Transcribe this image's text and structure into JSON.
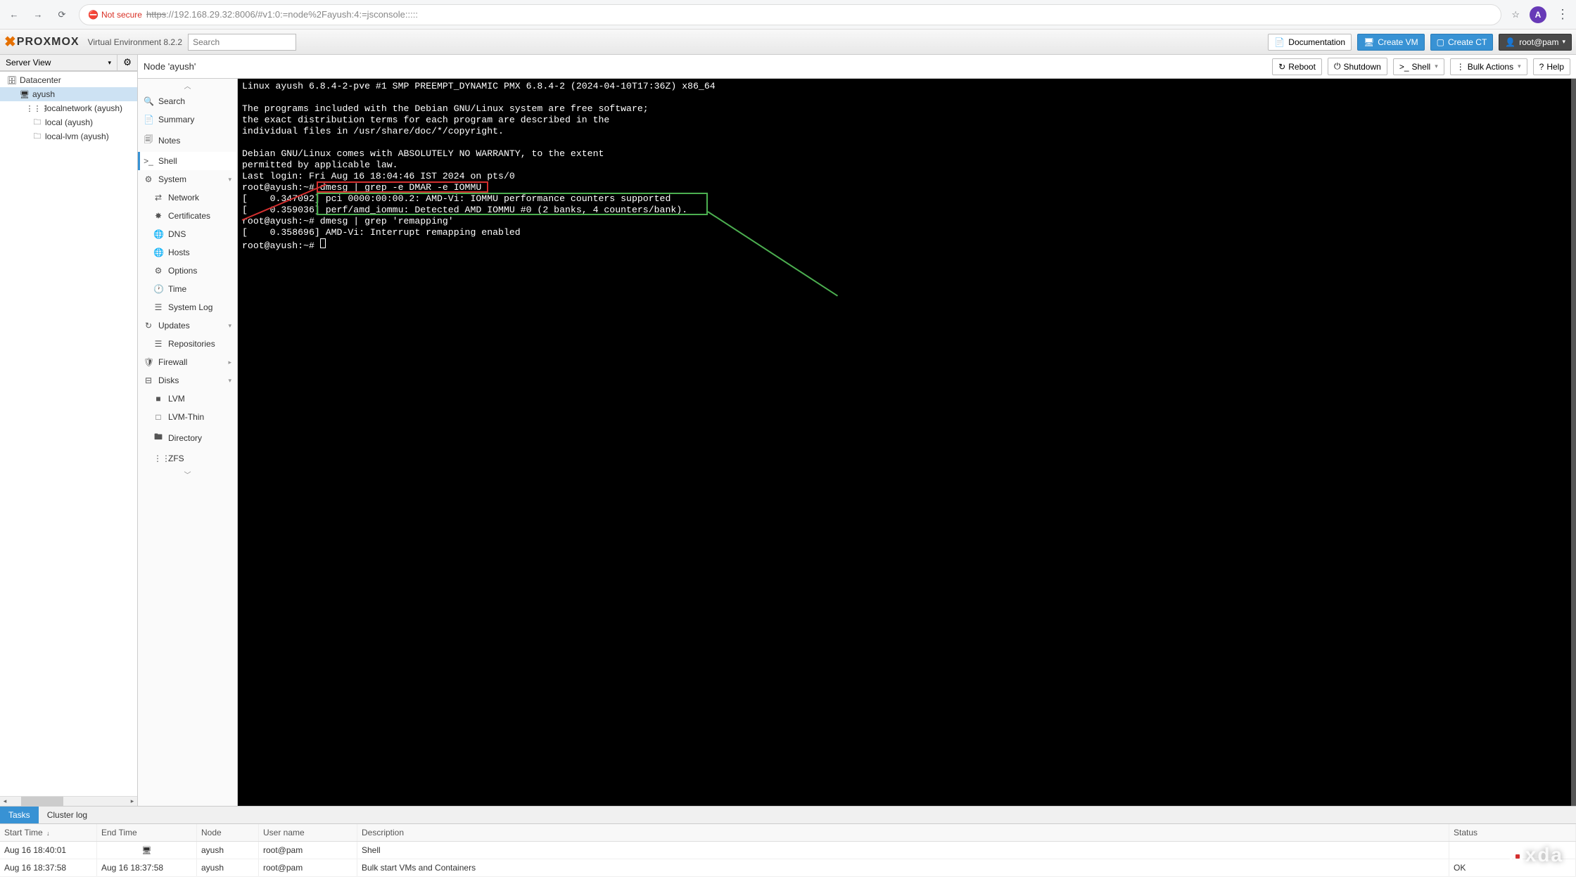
{
  "browser": {
    "security_label": "Not secure",
    "url_proto": "https",
    "url_rest": "://192.168.29.32:8006/#v1:0:=node%2Fayush:4:=jsconsole:::::",
    "avatar_letter": "A"
  },
  "header": {
    "logo_text": "PROXMOX",
    "product": "Virtual Environment",
    "version": "8.2.2",
    "search_placeholder": "Search",
    "doc_label": "Documentation",
    "create_vm": "Create VM",
    "create_ct": "Create CT",
    "user": "root@pam"
  },
  "server_tree": {
    "view_label": "Server View",
    "items": [
      {
        "label": "Datacenter",
        "icon": "🗄",
        "indent": 0
      },
      {
        "label": "ayush",
        "icon": "🖥",
        "indent": 1,
        "selected": true
      },
      {
        "label": "localnetwork (ayush)",
        "icon": "⋮⋮⋮",
        "indent": 2
      },
      {
        "label": "local (ayush)",
        "icon": "🗀",
        "indent": 2
      },
      {
        "label": "local-lvm (ayush)",
        "icon": "🗀",
        "indent": 2
      }
    ]
  },
  "content_header": {
    "title": "Node 'ayush'",
    "reboot": "Reboot",
    "shutdown": "Shutdown",
    "shell": "Shell",
    "bulk": "Bulk Actions",
    "help": "Help"
  },
  "side_nav": [
    {
      "label": "Search",
      "icon": "🔍"
    },
    {
      "label": "Summary",
      "icon": "📄"
    },
    {
      "label": "Notes",
      "icon": "🗐"
    },
    {
      "label": "Shell",
      "icon": ">_",
      "active": true
    },
    {
      "label": "System",
      "icon": "⚙",
      "expand": true
    },
    {
      "label": "Network",
      "icon": "⇄",
      "sub": true
    },
    {
      "label": "Certificates",
      "icon": "✸",
      "sub": true
    },
    {
      "label": "DNS",
      "icon": "🌐",
      "sub": true
    },
    {
      "label": "Hosts",
      "icon": "🌐",
      "sub": true
    },
    {
      "label": "Options",
      "icon": "⚙",
      "sub": true
    },
    {
      "label": "Time",
      "icon": "🕐",
      "sub": true
    },
    {
      "label": "System Log",
      "icon": "☰",
      "sub": true
    },
    {
      "label": "Updates",
      "icon": "↻",
      "expand": true
    },
    {
      "label": "Repositories",
      "icon": "☰",
      "sub": true
    },
    {
      "label": "Firewall",
      "icon": "🛡",
      "expand_r": true
    },
    {
      "label": "Disks",
      "icon": "⊟",
      "expand": true
    },
    {
      "label": "LVM",
      "icon": "■",
      "sub": true
    },
    {
      "label": "LVM-Thin",
      "icon": "□",
      "sub": true
    },
    {
      "label": "Directory",
      "icon": "🖿",
      "sub": true
    },
    {
      "label": "ZFS",
      "icon": "⋮⋮",
      "sub": true
    }
  ],
  "terminal": {
    "lines": [
      "Linux ayush 6.8.4-2-pve #1 SMP PREEMPT_DYNAMIC PMX 6.8.4-2 (2024-04-10T17:36Z) x86_64",
      "",
      "The programs included with the Debian GNU/Linux system are free software;",
      "the exact distribution terms for each program are described in the",
      "individual files in /usr/share/doc/*/copyright.",
      "",
      "Debian GNU/Linux comes with ABSOLUTELY NO WARRANTY, to the extent",
      "permitted by applicable law.",
      "Last login: Fri Aug 16 18:04:46 IST 2024 on pts/0",
      "root@ayush:~# dmesg | grep -e DMAR -e IOMMU",
      "[    0.347092] pci 0000:00:00.2: AMD-Vi: IOMMU performance counters supported",
      "[    0.359036] perf/amd_iommu: Detected AMD IOMMU #0 (2 banks, 4 counters/bank).",
      "root@ayush:~# dmesg | grep 'remapping'",
      "[    0.358696] AMD-Vi: Interrupt remapping enabled",
      "root@ayush:~# "
    ]
  },
  "tasks": {
    "tab_tasks": "Tasks",
    "tab_cluster": "Cluster log",
    "cols": [
      "Start Time",
      "End Time",
      "Node",
      "User name",
      "Description",
      "Status"
    ],
    "rows": [
      {
        "start": "Aug 16 18:40:01",
        "end": "",
        "end_icon": "🖥",
        "node": "ayush",
        "user": "root@pam",
        "desc": "Shell",
        "status": ""
      },
      {
        "start": "Aug 16 18:37:58",
        "end": "Aug 16 18:37:58",
        "node": "ayush",
        "user": "root@pam",
        "desc": "Bulk start VMs and Containers",
        "status": "OK"
      }
    ]
  },
  "watermark": "xda"
}
